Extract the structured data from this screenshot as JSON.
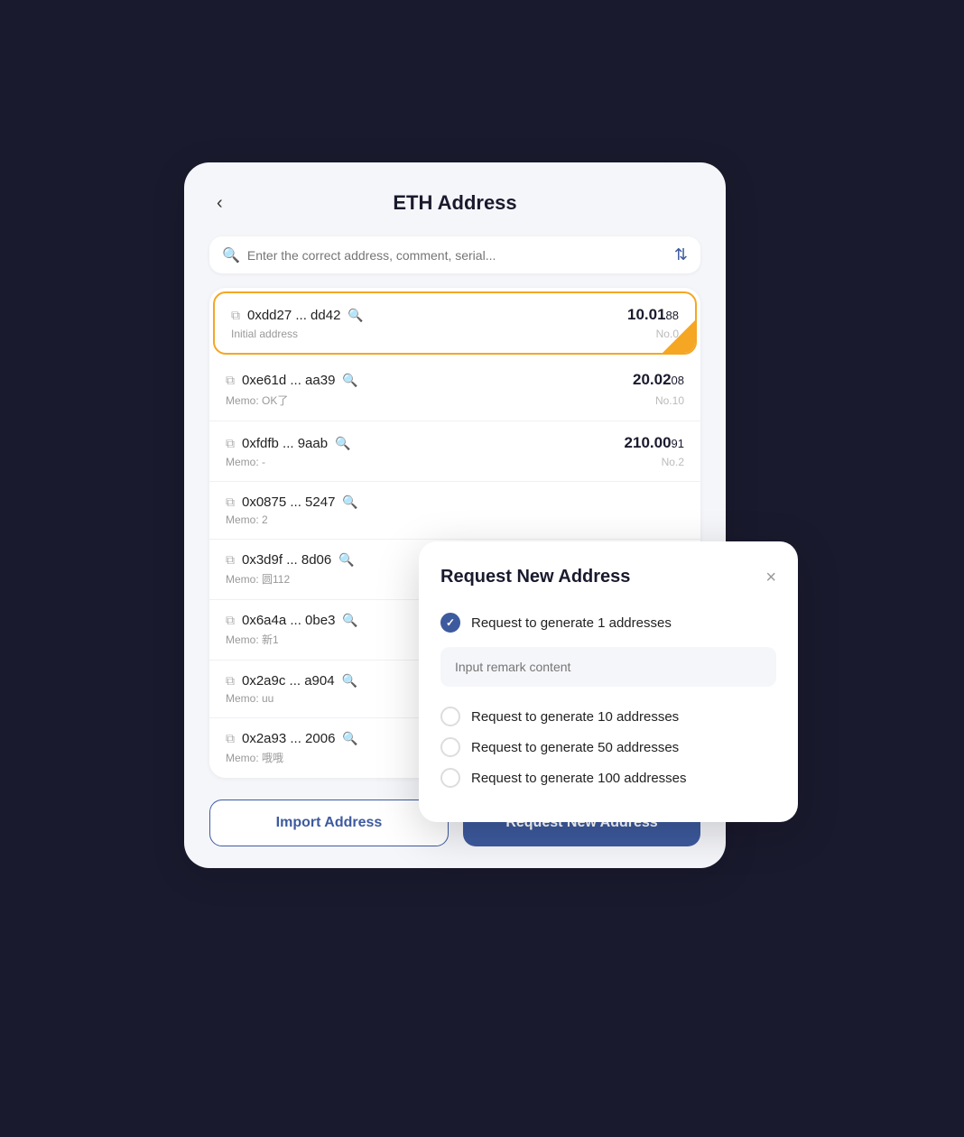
{
  "header": {
    "title": "ETH Address",
    "back_label": "‹"
  },
  "search": {
    "placeholder": "Enter the correct address, comment, serial..."
  },
  "addresses": [
    {
      "hash": "0xdd27 ... dd42",
      "amount_main": "10.01",
      "amount_decimal": "88",
      "memo": "Initial address",
      "number": "No.0",
      "active": true
    },
    {
      "hash": "0xe61d ... aa39",
      "amount_main": "20.02",
      "amount_decimal": "08",
      "memo": "Memo: OK了",
      "number": "No.10",
      "active": false
    },
    {
      "hash": "0xfdfb ... 9aab",
      "amount_main": "210.00",
      "amount_decimal": "91",
      "memo": "Memo: -",
      "number": "No.2",
      "active": false
    },
    {
      "hash": "0x0875 ... 5247",
      "amount_main": "",
      "amount_decimal": "",
      "memo": "Memo: 2",
      "number": "",
      "active": false
    },
    {
      "hash": "0x3d9f ... 8d06",
      "amount_main": "",
      "amount_decimal": "",
      "memo": "Memo: 圆112",
      "number": "",
      "active": false
    },
    {
      "hash": "0x6a4a ... 0be3",
      "amount_main": "",
      "amount_decimal": "",
      "memo": "Memo: 新1",
      "number": "",
      "active": false
    },
    {
      "hash": "0x2a9c ... a904",
      "amount_main": "",
      "amount_decimal": "",
      "memo": "Memo: uu",
      "number": "",
      "active": false
    },
    {
      "hash": "0x2a93 ... 2006",
      "amount_main": "",
      "amount_decimal": "",
      "memo": "Memo: 哦哦",
      "number": "",
      "active": false
    }
  ],
  "buttons": {
    "import": "Import Address",
    "request": "Request New Address"
  },
  "modal": {
    "title": "Request New Address",
    "close_label": "×",
    "remark_placeholder": "Input remark content",
    "options": [
      {
        "label": "Request to generate 1 addresses",
        "checked": true
      },
      {
        "label": "Request to generate 10 addresses",
        "checked": false
      },
      {
        "label": "Request to generate 50 addresses",
        "checked": false
      },
      {
        "label": "Request to generate 100 addresses",
        "checked": false
      }
    ]
  }
}
